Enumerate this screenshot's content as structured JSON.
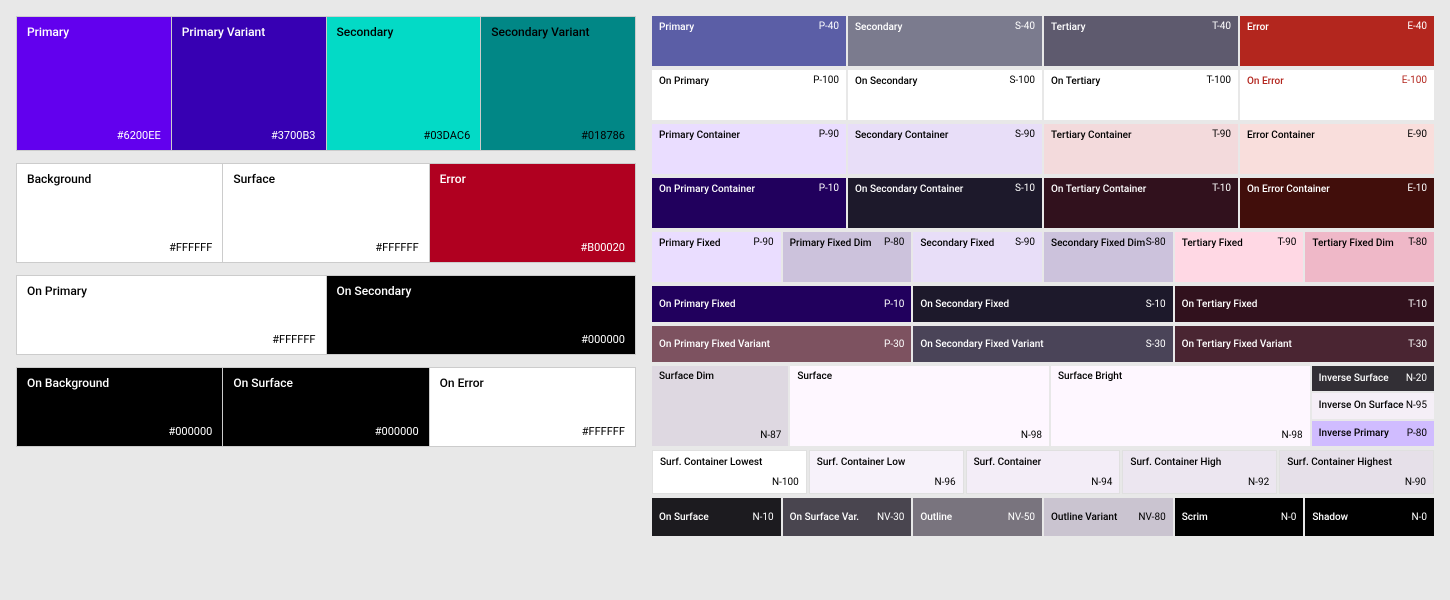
{
  "left": {
    "row1": [
      {
        "name": "Primary",
        "hex": "#6200EE",
        "bg": "#6200EE",
        "textColor": "#FFFFFF"
      },
      {
        "name": "Primary Variant",
        "hex": "#3700B3",
        "bg": "#3700B3",
        "textColor": "#FFFFFF"
      },
      {
        "name": "Secondary",
        "hex": "#03DAC6",
        "bg": "#03DAC6",
        "textColor": "#000000"
      },
      {
        "name": "Secondary Variant",
        "hex": "#018786",
        "bg": "#018786",
        "textColor": "#000000"
      }
    ],
    "row2": [
      {
        "name": "Background",
        "hex": "#FFFFFF",
        "bg": "#FFFFFF",
        "textColor": "#000000"
      },
      {
        "name": "Surface",
        "hex": "#FFFFFF",
        "bg": "#FFFFFF",
        "textColor": "#000000"
      },
      {
        "name": "Error",
        "hex": "#B00020",
        "bg": "#B00020",
        "textColor": "#FFFFFF"
      }
    ],
    "row3": [
      {
        "name": "On Primary",
        "hex": "#FFFFFF",
        "bg": "#FFFFFF",
        "textColor": "#000000"
      },
      {
        "name": "On Secondary",
        "hex": "#000000",
        "bg": "#000000",
        "textColor": "#FFFFFF"
      }
    ],
    "row4": [
      {
        "name": "On Background",
        "hex": "#000000",
        "bg": "#000000",
        "textColor": "#FFFFFF"
      },
      {
        "name": "On Surface",
        "hex": "#000000",
        "bg": "#000000",
        "textColor": "#FFFFFF"
      },
      {
        "name": "On Error",
        "hex": "#FFFFFF",
        "bg": "#FFFFFF",
        "textColor": "#000000"
      }
    ]
  },
  "right": {
    "row1": [
      {
        "label": "Primary",
        "code": "P-40",
        "bg": "#5B5EA6",
        "textColor": "#FFFFFF"
      },
      {
        "label": "Secondary",
        "code": "S-40",
        "bg": "#7B7B8E",
        "textColor": "#FFFFFF"
      },
      {
        "label": "Tertiary",
        "code": "T-40",
        "bg": "#5E5A6E",
        "textColor": "#FFFFFF"
      },
      {
        "label": "Error",
        "code": "E-40",
        "bg": "#B3261E",
        "textColor": "#FFFFFF"
      }
    ],
    "row2": [
      {
        "label": "On Primary",
        "code": "P-100",
        "bg": "#FFFFFF",
        "textColor": "#000000"
      },
      {
        "label": "On Secondary",
        "code": "S-100",
        "bg": "#FFFFFF",
        "textColor": "#000000"
      },
      {
        "label": "On Tertiary",
        "code": "T-100",
        "bg": "#FFFFFF",
        "textColor": "#000000"
      },
      {
        "label": "On Error",
        "code": "E-100",
        "bg": "#FFFFFF",
        "textColor": "#B3261E",
        "labelColor": "#B3261E"
      }
    ],
    "row3": [
      {
        "label": "Primary Container",
        "code": "P-90",
        "bg": "#EADDFF",
        "textColor": "#000000"
      },
      {
        "label": "Secondary Container",
        "code": "S-90",
        "bg": "#E8DEF8",
        "textColor": "#000000"
      },
      {
        "label": "Tertiary Container",
        "code": "T-90",
        "bg": "#F3DADC",
        "textColor": "#000000"
      },
      {
        "label": "Error Container",
        "code": "E-90",
        "bg": "#F9DEDC",
        "textColor": "#000000"
      }
    ],
    "row4": [
      {
        "label": "On Primary Container",
        "code": "P-10",
        "bg": "#21005D",
        "textColor": "#FFFFFF"
      },
      {
        "label": "On Secondary Container",
        "code": "S-10",
        "bg": "#1D192B",
        "textColor": "#FFFFFF"
      },
      {
        "label": "On Tertiary Container",
        "code": "T-10",
        "bg": "#31111D",
        "textColor": "#FFFFFF"
      },
      {
        "label": "On Error Container",
        "code": "E-10",
        "bg": "#410E0B",
        "textColor": "#FFFFFF"
      }
    ],
    "row5_fixed": [
      {
        "label": "Primary Fixed",
        "code": "P-90",
        "bg": "#EADDFF",
        "textColor": "#000000",
        "flex": 1
      },
      {
        "label": "Primary Fixed Dim",
        "code": "P-80",
        "bg": "#CCC2DC",
        "textColor": "#000000",
        "flex": 1
      },
      {
        "label": "Secondary Fixed",
        "code": "S-90",
        "bg": "#E8DEF8",
        "textColor": "#000000",
        "flex": 1
      },
      {
        "label": "Secondary Fixed Dim",
        "code": "S-80",
        "bg": "#CCC2DC",
        "textColor": "#000000",
        "flex": 1
      },
      {
        "label": "Tertiary Fixed",
        "code": "T-90",
        "bg": "#FFD8E4",
        "textColor": "#000000",
        "flex": 1
      },
      {
        "label": "Tertiary Fixed Dim",
        "code": "T-80",
        "bg": "#EFB8C8",
        "textColor": "#000000",
        "flex": 1
      }
    ],
    "row6_on_fixed": [
      {
        "label": "On Primary Fixed",
        "code": "P-10",
        "bg": "#21005D",
        "textColor": "#FFFFFF",
        "flex": 2
      },
      {
        "label": "On Secondary Fixed",
        "code": "S-10",
        "bg": "#1D192B",
        "textColor": "#FFFFFF",
        "flex": 2
      },
      {
        "label": "On Tertiary Fixed",
        "code": "T-10",
        "bg": "#31111D",
        "textColor": "#FFFFFF",
        "flex": 2
      }
    ],
    "row7_on_fixed_variant": [
      {
        "label": "On Primary Fixed Variant",
        "code": "P-30",
        "bg": "#7D5260",
        "textColor": "#FFFFFF",
        "flex": 2
      },
      {
        "label": "On Secondary Fixed Variant",
        "code": "S-30",
        "bg": "#4A4458",
        "textColor": "#FFFFFF",
        "flex": 2
      },
      {
        "label": "On Tertiary Fixed Variant",
        "code": "T-30",
        "bg": "#4A2532",
        "textColor": "#FFFFFF",
        "flex": 2
      }
    ],
    "row8_surface": [
      {
        "label": "Surface Dim",
        "code": "N-87",
        "bg": "#DED8E1",
        "textColor": "#000000",
        "flex": 1
      },
      {
        "label": "Surface",
        "code": "N-98",
        "bg": "#FEF7FF",
        "textColor": "#000000",
        "flex": 2
      },
      {
        "label": "Surface Bright",
        "code": "N-98",
        "bg": "#FEF7FF",
        "textColor": "#000000",
        "flex": 2
      },
      {
        "label": "Inverse Surface",
        "code": "N-20",
        "bg": "#322F35",
        "textColor": "#FFFFFF",
        "flex": 1
      }
    ],
    "row9_inverse": [
      {
        "label": "Inverse On Surface",
        "code": "N-95",
        "bg": "#F5EFF7",
        "textColor": "#000000"
      }
    ],
    "row9_inverse_primary": [
      {
        "label": "Inverse Primary",
        "code": "P-80",
        "bg": "#D0BCFF",
        "textColor": "#000000"
      }
    ],
    "row10_surf_container": [
      {
        "label": "Surf. Container Lowest",
        "code": "N-100",
        "bg": "#FFFFFF",
        "textColor": "#000000"
      },
      {
        "label": "Surf. Container Low",
        "code": "N-96",
        "bg": "#F7F2FA",
        "textColor": "#000000"
      },
      {
        "label": "Surf. Container",
        "code": "N-94",
        "bg": "#F3EDF7",
        "textColor": "#000000"
      },
      {
        "label": "Surf. Container High",
        "code": "N-92",
        "bg": "#ECE6F0",
        "textColor": "#000000"
      },
      {
        "label": "Surf. Container Highest",
        "code": "N-90",
        "bg": "#E6E0E9",
        "textColor": "#000000"
      }
    ],
    "row11_bottom": [
      {
        "label": "On Surface",
        "code": "N-10",
        "bg": "#1C1B1F",
        "textColor": "#FFFFFF"
      },
      {
        "label": "On Surface Var.",
        "code": "NV-30",
        "bg": "#49454F",
        "textColor": "#FFFFFF"
      },
      {
        "label": "Outline",
        "code": "NV-50",
        "bg": "#79747E",
        "textColor": "#FFFFFF"
      },
      {
        "label": "Outline Variant",
        "code": "NV-80",
        "bg": "#CAC4D0",
        "textColor": "#000000"
      },
      {
        "label": "Scrim",
        "code": "N-0",
        "bg": "#000000",
        "textColor": "#FFFFFF"
      },
      {
        "label": "Shadow",
        "code": "N-0",
        "bg": "#000000",
        "textColor": "#FFFFFF"
      }
    ]
  }
}
